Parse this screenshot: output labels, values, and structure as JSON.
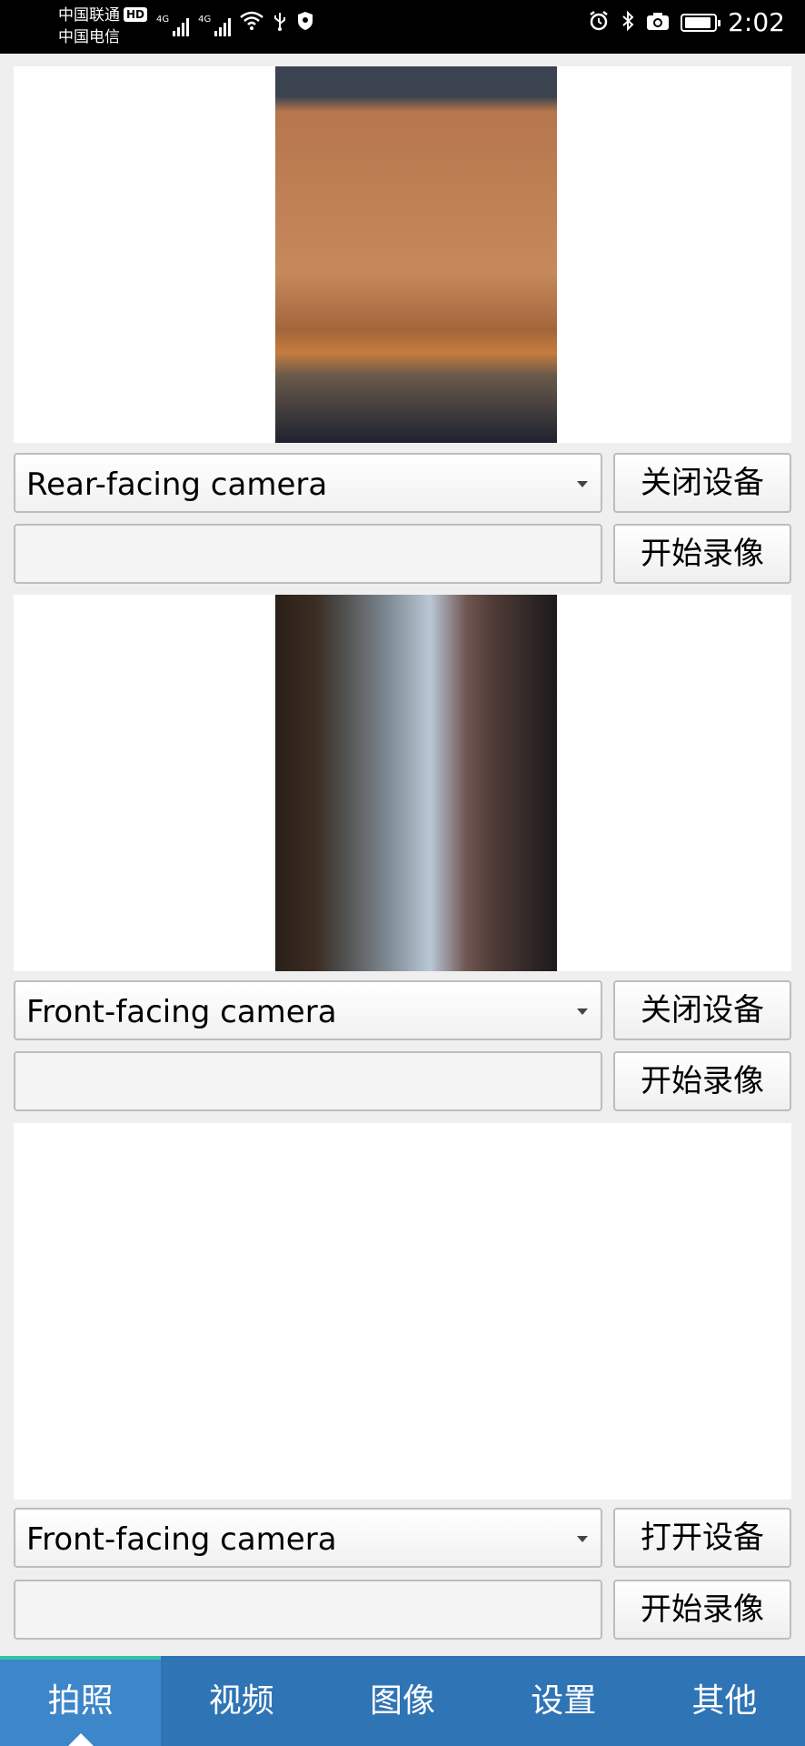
{
  "status_bar": {
    "carrier_1": "中国联通",
    "carrier_1_badge": "HD",
    "carrier_2": "中国电信",
    "net_1": "4G",
    "net_2": "4G",
    "time": "2:02"
  },
  "panels": [
    {
      "camera_select": "Rear-facing camera",
      "device_button": "关闭设备",
      "record_input": "",
      "record_button": "开始录像",
      "has_preview": true
    },
    {
      "camera_select": "Front-facing camera",
      "device_button": "关闭设备",
      "record_input": "",
      "record_button": "开始录像",
      "has_preview": true
    },
    {
      "camera_select": "Front-facing camera",
      "device_button": "打开设备",
      "record_input": "",
      "record_button": "开始录像",
      "has_preview": false
    }
  ],
  "tabs": [
    {
      "label": "拍照",
      "active": true
    },
    {
      "label": "视频",
      "active": false
    },
    {
      "label": "图像",
      "active": false
    },
    {
      "label": "设置",
      "active": false
    },
    {
      "label": "其他",
      "active": false
    }
  ],
  "colors": {
    "tabbar": "#2f74b5",
    "tab_active": "#3d86c9",
    "tab_indicator": "#35c4a4",
    "page_bg": "#efefef"
  }
}
